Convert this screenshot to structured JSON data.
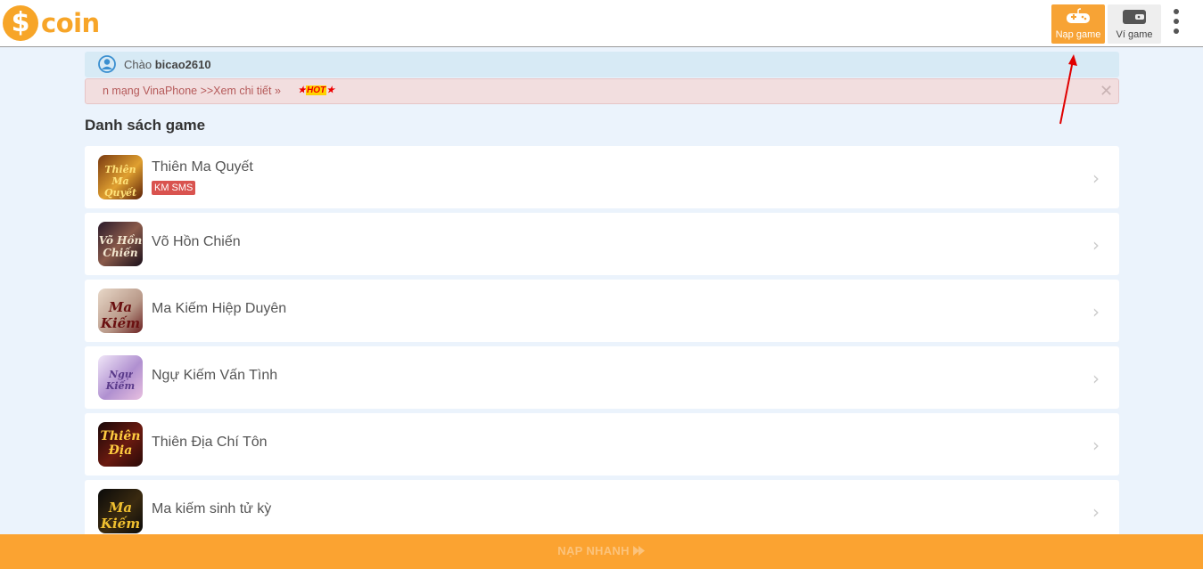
{
  "header": {
    "logo_text": "coin",
    "logo_symbol": "$",
    "nap_game_label": "Nạp game",
    "vi_game_label": "Ví game",
    "brand_color": "#f7a528"
  },
  "greeting": {
    "prefix": "Chào",
    "username": "bicao2610"
  },
  "notice": {
    "message": "n mạng VinaPhone >>Xem chi tiết »",
    "hot_label": "HOT",
    "close_symbol": "✕"
  },
  "section_title": "Danh sách game",
  "games": [
    {
      "name": "Thiên Ma Quyết",
      "badge": "KM SMS",
      "icon": "thien-ma-quyet-icon"
    },
    {
      "name": "Võ Hồn Chiến",
      "icon": "vo-hon-chien-icon"
    },
    {
      "name": "Ma Kiếm Hiệp Duyên",
      "icon": "ma-kiem-hiep-duyen-icon"
    },
    {
      "name": "Ngự Kiếm Vấn Tình",
      "icon": "ngu-kiem-van-tinh-icon"
    },
    {
      "name": "Thiên Địa Chí Tôn",
      "icon": "thien-dia-chi-ton-icon"
    },
    {
      "name": "Ma kiếm sinh tử kỳ",
      "icon": "ma-kiem-sinh-tu-ky-icon"
    }
  ],
  "bottom_button": "NẠP NHANH",
  "chevron": "›",
  "accent_colors": {
    "orange": "#f7a335",
    "info_bg": "#d7eaf5",
    "danger_bg": "#f2dedf",
    "badge": "#d9534f",
    "annotation_arrow": "#e00000"
  }
}
